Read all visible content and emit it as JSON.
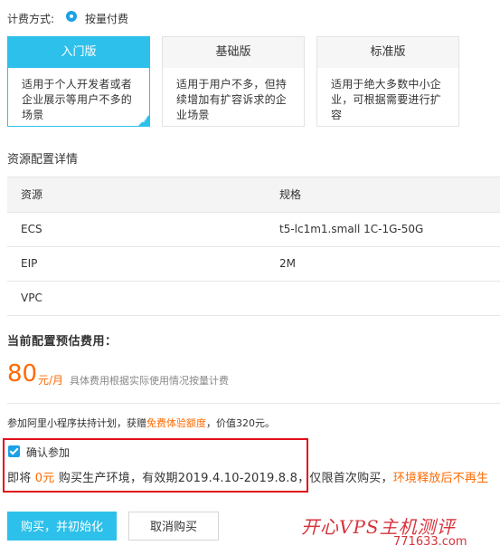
{
  "billing": {
    "label": "计费方式:",
    "option": "按量付费"
  },
  "editions": [
    {
      "title": "入门版",
      "desc": "适用于个人开发者或者企业展示等用户不多的场景",
      "selected": true
    },
    {
      "title": "基础版",
      "desc": "适用于用户不多，但持续增加有扩容诉求的企业场景",
      "selected": false
    },
    {
      "title": "标准版",
      "desc": "适用于绝大多数中小企业，可根据需要进行扩容",
      "selected": false
    }
  ],
  "resource": {
    "title": "资源配置详情",
    "headers": [
      "资源",
      "规格"
    ],
    "rows": [
      [
        "ECS",
        "t5-lc1m1.small 1C-1G-50G"
      ],
      [
        "EIP",
        "2M"
      ],
      [
        "VPC",
        ""
      ]
    ]
  },
  "estimate": {
    "title": "当前配置预估费用：",
    "price": "80",
    "unit": "元/月",
    "note": "具体费用根据实际使用情况按量计费"
  },
  "promo": {
    "prefix": "参加阿里小程序扶持计划，获赠",
    "highlight": "免费体验额度",
    "suffix": "，价值320元。"
  },
  "confirm": {
    "label": "确认参加",
    "note_prefix": "即将 ",
    "note_price": "0元",
    "note_mid": " 购买生产环境，有效期2019.4.10-2019.8.8，仅限首次购买，",
    "note_warn": "环境释放后不再生"
  },
  "buttons": {
    "primary": "购买，并初始化",
    "secondary": "取消购买"
  },
  "watermark": {
    "text": "开心VPS主机测评",
    "sub": "771633.com"
  },
  "colors": {
    "accent": "#2dc0ea",
    "price": "#ff6a00",
    "highlight_box": "#e0101b"
  }
}
